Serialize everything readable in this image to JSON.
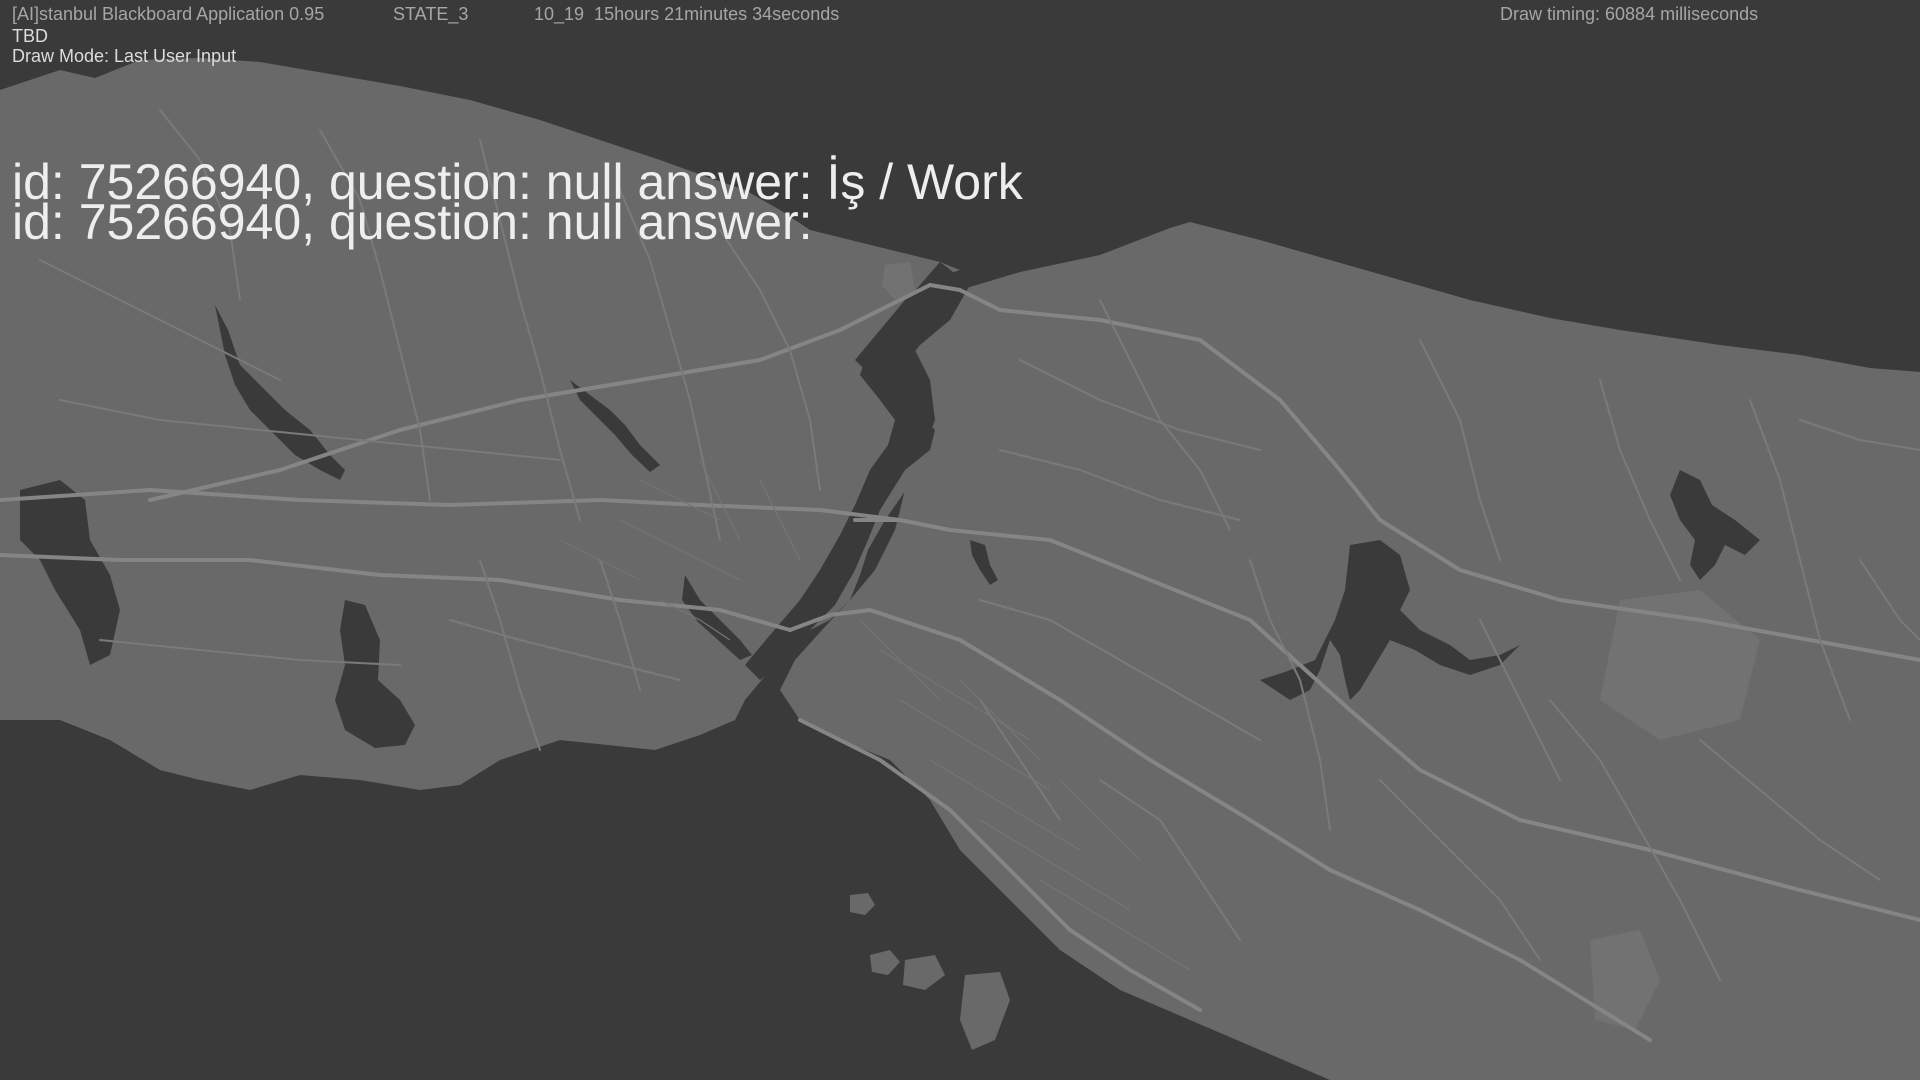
{
  "header": {
    "app_title": "[AI]stanbul Blackboard Application 0.95",
    "state": "STATE_3",
    "elapsed": "10_19  15hours 21minutes 34seconds",
    "draw_timing": "Draw timing: 60884 milliseconds",
    "tbd": "TBD",
    "draw_mode": "Draw Mode: Last User Input"
  },
  "qa": [
    {
      "text": "id: 75266940, question: null answer: İş / Work"
    },
    {
      "text": "id: 75266940, question: null answer:"
    }
  ],
  "map": {
    "colors": {
      "water": "#3a3a3a",
      "land": "#696969",
      "road": "#7c7c7c",
      "major_road": "#858585",
      "park": "#727272"
    }
  }
}
